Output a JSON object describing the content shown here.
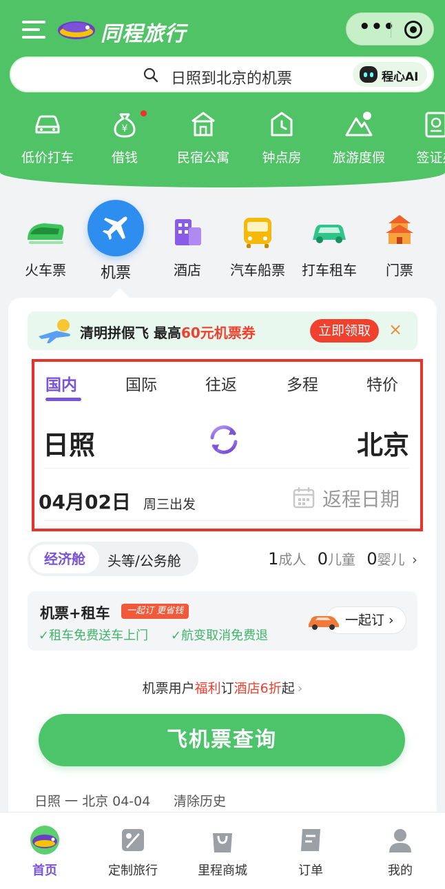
{
  "header": {
    "app_title": "同程旅行",
    "menu_icon": "hamburger-menu-icon",
    "capsule": {
      "more": "•••",
      "more_icon": "more-dots-icon",
      "close_icon": "target-circle-icon"
    }
  },
  "search": {
    "placeholder": "日照到北京的机票",
    "ai_label": "程心AI",
    "icon": "search-icon",
    "ai_icon": "robot-icon"
  },
  "services": [
    {
      "label": "低价打车",
      "icon": "car-icon"
    },
    {
      "label": "借钱",
      "icon": "money-bag-icon",
      "dot": true
    },
    {
      "label": "民宿公寓",
      "icon": "house-icon"
    },
    {
      "label": "钟点房",
      "icon": "clock-house-icon"
    },
    {
      "label": "旅游度假",
      "icon": "mountain-icon"
    },
    {
      "label": "签证办",
      "icon": "passport-icon"
    }
  ],
  "categories": [
    {
      "label": "火车票",
      "icon": "train-icon"
    },
    {
      "label": "机票",
      "icon": "airplane-icon",
      "active": true
    },
    {
      "label": "酒店",
      "icon": "hotel-building-icon"
    },
    {
      "label": "汽车船票",
      "icon": "bus-icon"
    },
    {
      "label": "打车租车",
      "icon": "taxi-icon"
    },
    {
      "label": "门票",
      "icon": "temple-icon"
    }
  ],
  "promo": {
    "prefix": "清明拼假飞 最高",
    "amount": "60元机票券",
    "button": "立即领取",
    "close": "×"
  },
  "flight": {
    "tabs": [
      "国内",
      "国际",
      "往返",
      "多程",
      "特价"
    ],
    "active_tab": 0,
    "from_city": "日照",
    "to_city": "北京",
    "date": "04月02日",
    "weekday": "周三出发",
    "return_date": "返程日期"
  },
  "cabin": {
    "economy": "经济舱",
    "business": "头等/公务舱"
  },
  "passengers": {
    "adults": "1",
    "adults_label": "成人",
    "children": "0",
    "children_label": "儿童",
    "infants": "0",
    "infants_label": "婴儿",
    "chevron": "›"
  },
  "rental": {
    "title": "机票+租车",
    "tag": "一起订 更省钱",
    "feature1": "✓租车免费送车上门",
    "feature2": "✓航变取消免费退",
    "button": "一起订 ›"
  },
  "hotel_offer": {
    "p1": "机票用户",
    "p2": "福利",
    "p3": "订",
    "p4": "酒店6折",
    "p5": "起",
    "chevron": "›"
  },
  "search_button": "飞机票查询",
  "history": {
    "route": "日照 一 北京 04-04",
    "clear": "清除历史"
  },
  "tabbar": [
    {
      "label": "首页",
      "icon": "home-mascot-icon",
      "active": true
    },
    {
      "label": "定制旅行",
      "icon": "custom-trip-icon"
    },
    {
      "label": "里程商城",
      "icon": "shopping-bag-icon"
    },
    {
      "label": "订单",
      "icon": "order-list-icon"
    },
    {
      "label": "我的",
      "icon": "profile-icon"
    }
  ],
  "colors": {
    "brand_green": "#4fc365",
    "accent_purple": "#7a54d8",
    "promo_red": "#f0402e",
    "highlight_box": "#e8332a"
  }
}
